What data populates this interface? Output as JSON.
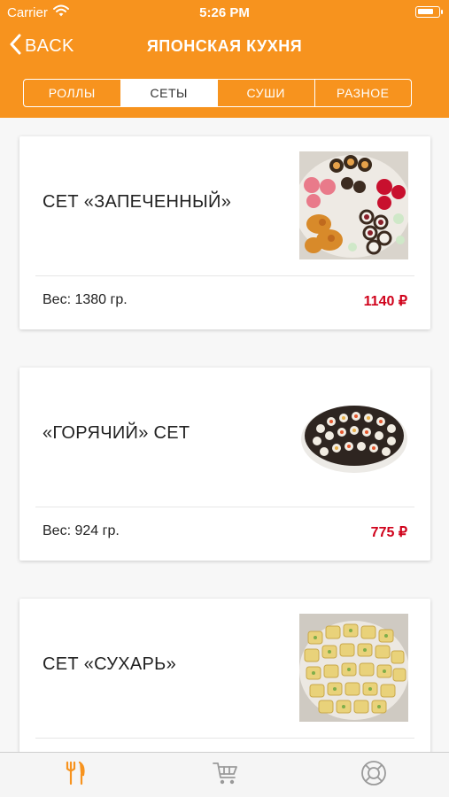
{
  "status_bar": {
    "carrier": "Carrier",
    "time": "5:26 PM",
    "battery_level": 0.75
  },
  "nav": {
    "back_label": "BACK",
    "title": "ЯПОНСКАЯ КУХНЯ"
  },
  "segments": [
    {
      "label": "РОЛЛЫ",
      "active": false
    },
    {
      "label": "СЕТЫ",
      "active": true
    },
    {
      "label": "СУШИ",
      "active": false
    },
    {
      "label": "РАЗНОЕ",
      "active": false
    }
  ],
  "products": [
    {
      "title": "СЕТ «ЗАПЕЧЕННЫЙ»",
      "weight": "Вес: 1380 гр.",
      "price": "1140 ₽"
    },
    {
      "title": "«ГОРЯЧИЙ» СЕТ",
      "weight": "Вес: 924 гр.",
      "price": "775 ₽"
    },
    {
      "title": "СЕТ «СУХАРЬ»",
      "weight": "",
      "price": ""
    }
  ],
  "tab_bar": [
    {
      "icon": "fork-knife-icon",
      "active": true
    },
    {
      "icon": "cart-icon",
      "active": false
    },
    {
      "icon": "lifebuoy-icon",
      "active": false
    }
  ],
  "colors": {
    "brand": "#f7931e",
    "price": "#d0021b",
    "tab_active": "#f7931e",
    "tab_inactive": "#9a9a9a"
  }
}
